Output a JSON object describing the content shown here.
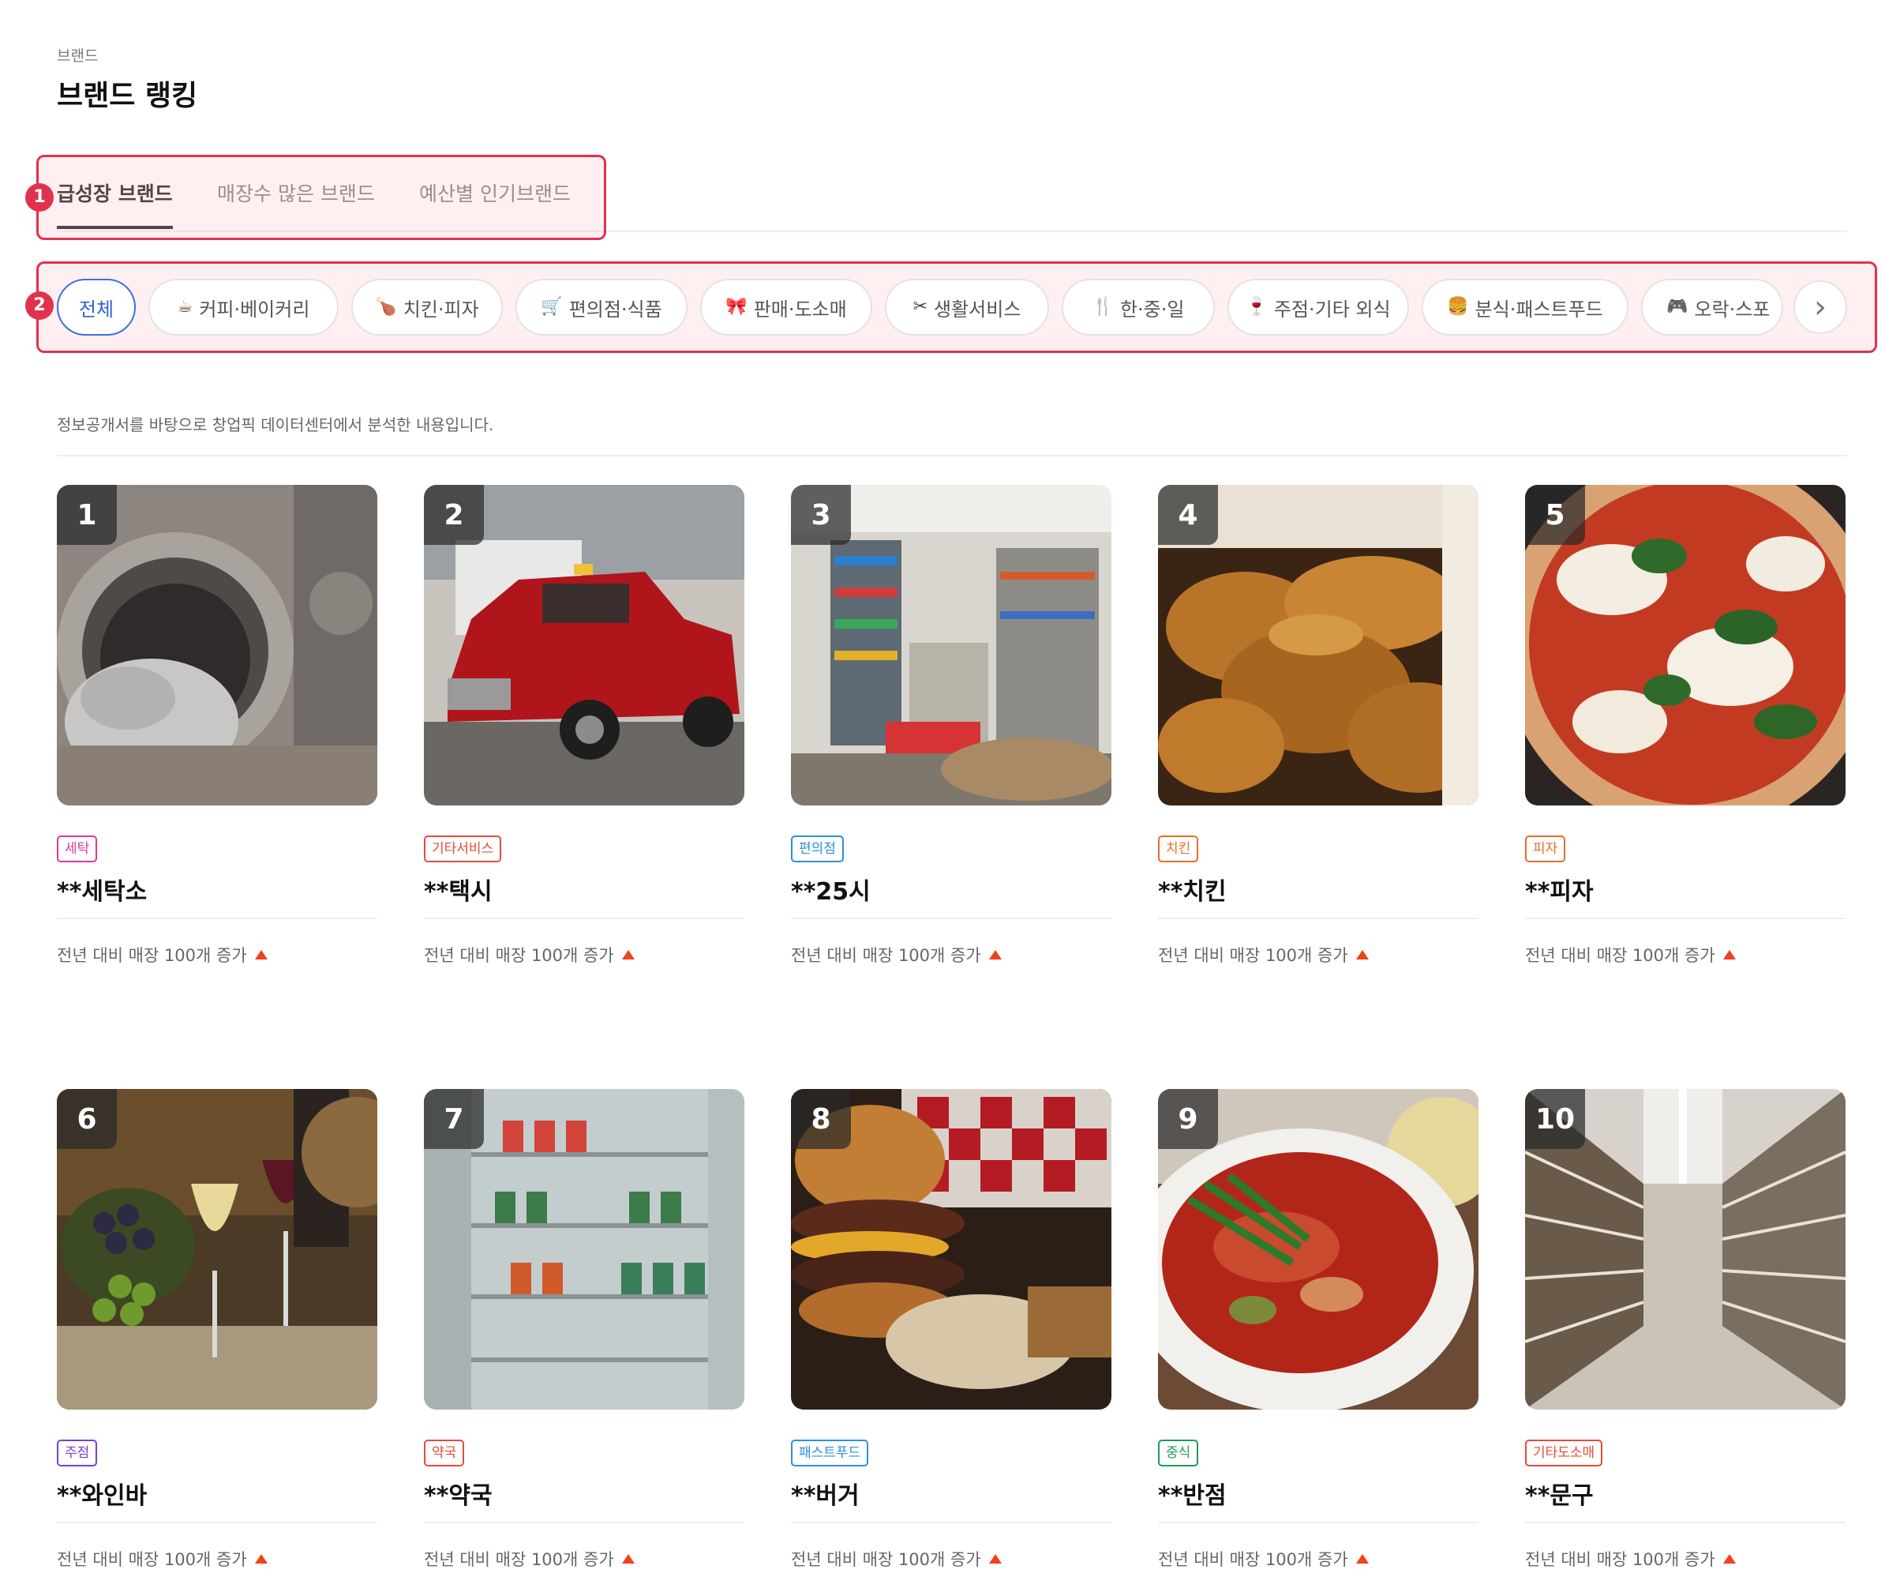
{
  "breadcrumb": "브랜드",
  "page_title": "브랜드 랭킹",
  "annotations": [
    "1",
    "2"
  ],
  "tabs": [
    {
      "label": "급성장 브랜드",
      "active": true
    },
    {
      "label": "매장수 많은 브랜드",
      "active": false
    },
    {
      "label": "예산별 인기브랜드",
      "active": false
    }
  ],
  "categories": [
    {
      "label": "전체",
      "icon": "",
      "active": true
    },
    {
      "label": "커피·베이커리",
      "icon": "coffee-bakery-icon",
      "active": false
    },
    {
      "label": "치킨·피자",
      "icon": "chicken-pizza-icon",
      "active": false
    },
    {
      "label": "편의점·식품",
      "icon": "convenience-food-icon",
      "active": false
    },
    {
      "label": "판매·도소매",
      "icon": "retail-gift-icon",
      "active": false
    },
    {
      "label": "생활서비스",
      "icon": "tools-icon",
      "active": false
    },
    {
      "label": "한·중·일",
      "icon": "utensils-icon",
      "active": false
    },
    {
      "label": "주점·기타 외식",
      "icon": "drinks-icon",
      "active": false
    },
    {
      "label": "분식·패스트푸드",
      "icon": "fast-food-icon",
      "active": false
    },
    {
      "label": "오락·스포",
      "icon": "game-icon",
      "active": false
    }
  ],
  "category_next": "›",
  "notice": "정보공개서를 바탕으로 창업픽 데이터센터에서 분석한 내용입니다.",
  "brands": [
    {
      "rank": "1",
      "category": "세탁",
      "category_color": "#e0399b",
      "name": "**세탁소",
      "growth": "전년 대비 매장 100개 증가",
      "image": "washing-machine-photo"
    },
    {
      "rank": "2",
      "category": "기타서비스",
      "category_color": "#e84a3c",
      "name": "**택시",
      "growth": "전년 대비 매장 100개 증가",
      "image": "red-taxi-photo"
    },
    {
      "rank": "3",
      "category": "편의점",
      "category_color": "#2f8fe0",
      "name": "**25시",
      "growth": "전년 대비 매장 100개 증가",
      "image": "convenience-store-photo"
    },
    {
      "rank": "4",
      "category": "치킨",
      "category_color": "#ef6a2e",
      "name": "**치킨",
      "growth": "전년 대비 매장 100개 증가",
      "image": "fried-chicken-photo"
    },
    {
      "rank": "5",
      "category": "피자",
      "category_color": "#ef6a2e",
      "name": "**피자",
      "growth": "전년 대비 매장 100개 증가",
      "image": "pizza-photo"
    },
    {
      "rank": "6",
      "category": "주점",
      "category_color": "#7a3fd0",
      "name": "**와인바",
      "growth": "전년 대비 매장 100개 증가",
      "image": "wine-photo"
    },
    {
      "rank": "7",
      "category": "약국",
      "category_color": "#e84a3c",
      "name": "**약국",
      "growth": "전년 대비 매장 100개 증가",
      "image": "pharmacy-shelves-photo"
    },
    {
      "rank": "8",
      "category": "패스트푸드",
      "category_color": "#2f8fe0",
      "name": "**버거",
      "growth": "전년 대비 매장 100개 증가",
      "image": "burger-photo"
    },
    {
      "rank": "9",
      "category": "중식",
      "category_color": "#1f9a5a",
      "name": "**반점",
      "growth": "전년 대비 매장 100개 증가",
      "image": "jjamppong-photo"
    },
    {
      "rank": "10",
      "category": "기타도소매",
      "category_color": "#e84a3c",
      "name": "**문구",
      "growth": "전년 대비 매장 100개 증가",
      "image": "supermarket-aisle-photo"
    }
  ]
}
